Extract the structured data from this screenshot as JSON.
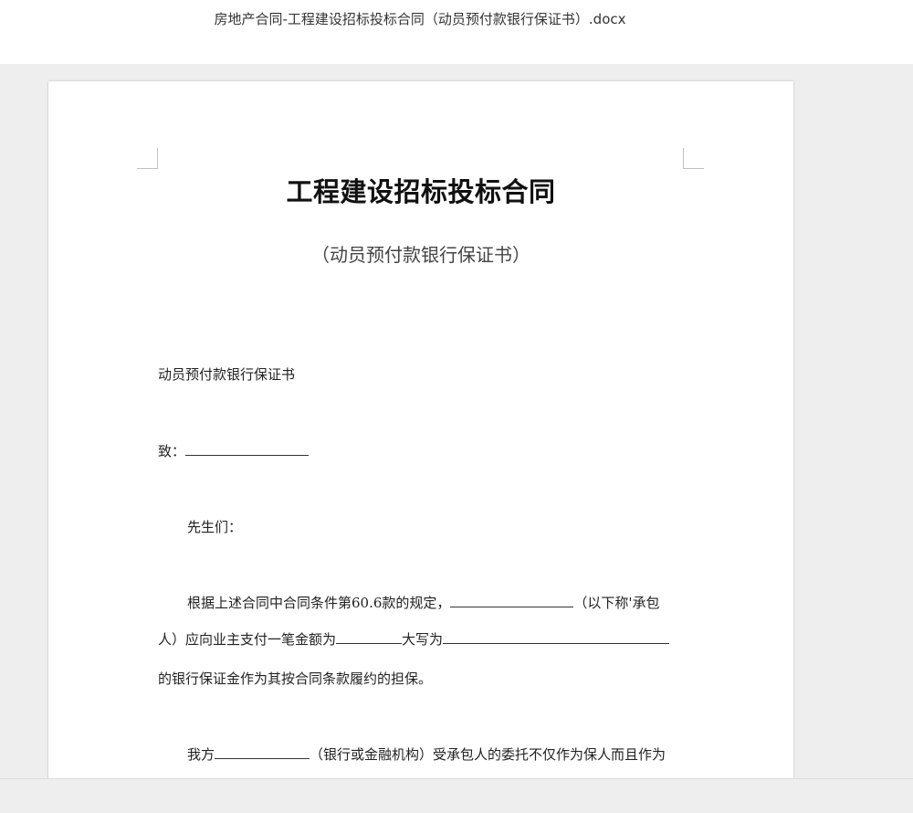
{
  "header": {
    "file_title": "房地产合同-工程建设招标投标合同（动员预付款银行保证书）.docx"
  },
  "document": {
    "title": "工程建设招标投标合同",
    "subtitle": "（动员预付款银行保证书）",
    "heading": "动员预付款银行保证书",
    "to_label": "致：",
    "salutation": "先生们：",
    "p1_a": "根据上述合同中合同条件第60.6款的规定，",
    "p1_b": "（以下称'承包",
    "p1_c": "人）应向业主支付一笔金额为",
    "p1_d": "大写为",
    "p1_e": "的银行保证金作为其按合同条款履约的担保。",
    "p2_a": "我方",
    "p2_b": "（银行或金融机构）受承包人的委托不仅作为保人而且作为"
  }
}
